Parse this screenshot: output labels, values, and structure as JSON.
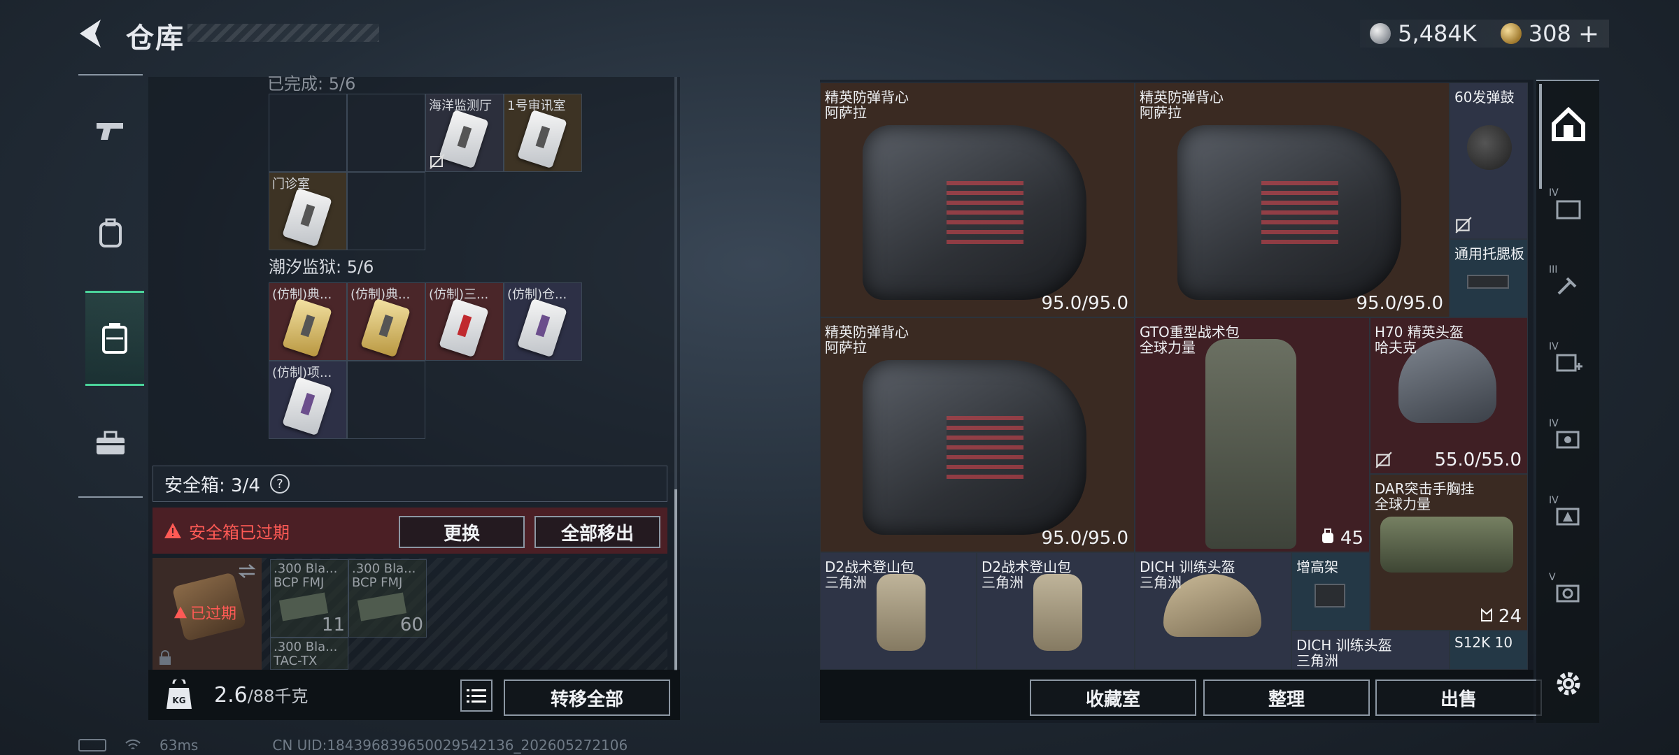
{
  "header": {
    "title": "仓库",
    "silver": "5,484K",
    "gold": "308",
    "gold_plus": "+"
  },
  "stash": {
    "partial_header": "已完成: 5/6",
    "cards_top": [
      "海洋监测厅",
      "1号审讯室"
    ],
    "card_clinic": "门诊室",
    "prison_label": "潮汐监狱: 5/6",
    "prison_cards": [
      "(仿制)典...",
      "(仿制)典...",
      "(仿制)三...",
      "(仿制)仓...",
      "(仿制)项..."
    ]
  },
  "safe": {
    "label": "安全箱: 3/4",
    "help": "?",
    "expired_notice": "安全箱已过期",
    "replace_btn": "更换",
    "remove_all_btn": "全部移出",
    "case_status": "已过期",
    "ammo": [
      {
        "name": ".300 Bla...",
        "sub": "BCP FMJ",
        "count": "11"
      },
      {
        "name": ".300 Bla...",
        "sub": "BCP FMJ",
        "count": "60"
      },
      {
        "name": ".300 Bla...",
        "sub": "TAC-TX",
        "count": ""
      }
    ]
  },
  "footer_left": {
    "weight": "2.6",
    "capacity": "/88千克",
    "transfer_all": "转移全部"
  },
  "items": [
    {
      "n1": "精英防弹背心",
      "n2": "阿萨拉",
      "dur": "95.0/95.0"
    },
    {
      "n1": "精英防弹背心",
      "n2": "阿萨拉",
      "dur": "95.0/95.0"
    },
    {
      "n1": "60发弹鼓",
      "n2": "",
      "dur": ""
    },
    {
      "n1": "通用托腮板",
      "n2": "",
      "dur": ""
    },
    {
      "n1": "精英防弹背心",
      "n2": "阿萨拉",
      "dur": "95.0/95.0"
    },
    {
      "n1": "GTO重型战术包",
      "n2": "全球力量",
      "dur": "45"
    },
    {
      "n1": "H70 精英头盔",
      "n2": "哈夫克",
      "dur": "55.0/55.0"
    },
    {
      "n1": "DAR突击手胸挂",
      "n2": "全球力量",
      "dur": "24"
    },
    {
      "n1": "D2战术登山包",
      "n2": "三角洲",
      "dur": ""
    },
    {
      "n1": "D2战术登山包",
      "n2": "三角洲",
      "dur": ""
    },
    {
      "n1": "DICH 训练头盔",
      "n2": "三角洲",
      "dur": ""
    },
    {
      "n1": "增高架",
      "n2": "",
      "dur": ""
    },
    {
      "n1": "DICH 训练头盔",
      "n2": "三角洲",
      "dur": ""
    },
    {
      "n1": "S12K 10",
      "n2": "",
      "dur": ""
    }
  ],
  "footer_right": {
    "collection": "收藏室",
    "organize": "整理",
    "sell": "出售"
  },
  "rrail_levels": [
    "IV",
    "III",
    "IV",
    "IV",
    "IV",
    "V"
  ],
  "status": {
    "ping": "63ms",
    "uid": "CN UID:18439683965002954213​6_202605272106"
  },
  "colors": {
    "accent_green": "#4bd39a",
    "alert_red": "#ff5a55"
  }
}
